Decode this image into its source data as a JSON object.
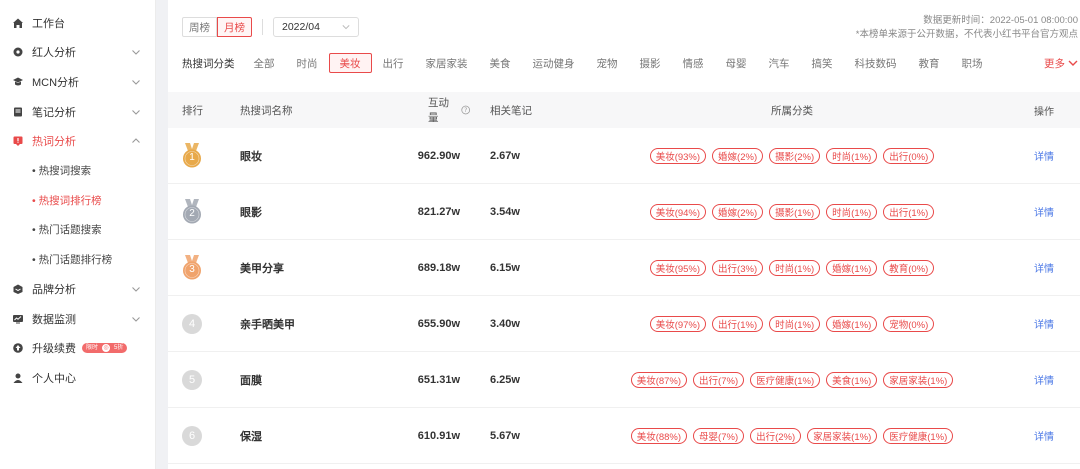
{
  "sidebar": {
    "items": [
      {
        "label": "工作台",
        "icon": "home-icon",
        "chevron": false,
        "active": false
      },
      {
        "label": "红人分析",
        "icon": "gear-icon",
        "chevron": true,
        "active": false
      },
      {
        "label": "MCN分析",
        "icon": "cap-icon",
        "chevron": true,
        "active": false
      },
      {
        "label": "笔记分析",
        "icon": "note-icon",
        "chevron": true,
        "active": false
      },
      {
        "label": "热词分析",
        "icon": "hot-word-icon",
        "chevron": true,
        "active": true,
        "expanded": true
      }
    ],
    "sub_items": [
      {
        "label": "• 热搜词搜索",
        "active": false
      },
      {
        "label": "• 热搜词排行榜",
        "active": true
      },
      {
        "label": "• 热门话题搜索",
        "active": false
      },
      {
        "label": "• 热门话题排行榜",
        "active": false
      }
    ],
    "items_after": [
      {
        "label": "品牌分析",
        "icon": "brand-icon",
        "chevron": true
      },
      {
        "label": "数据监测",
        "icon": "monitor-icon",
        "chevron": true
      },
      {
        "label": "升级续费",
        "icon": "upgrade-icon",
        "chevron": false,
        "badge_left": "限时",
        "badge_right": "5折"
      },
      {
        "label": "个人中心",
        "icon": "user-icon",
        "chevron": false
      }
    ]
  },
  "toolbar": {
    "week_label": "周榜",
    "month_label": "月榜",
    "date_value": "2022/04",
    "update_time": "数据更新时间：2022-05-01 08:00:00",
    "disclaimer": "*本榜单来源于公开数据，不代表小红书平台官方观点"
  },
  "categories": {
    "label": "热搜词分类",
    "items": [
      "全部",
      "时尚",
      "美妆",
      "出行",
      "家居家装",
      "美食",
      "运动健身",
      "宠物",
      "摄影",
      "情感",
      "母婴",
      "汽车",
      "搞笑",
      "科技数码",
      "教育",
      "职场"
    ],
    "active_index": 2,
    "more_label": "更多"
  },
  "table": {
    "headers": {
      "rank": "排行",
      "name": "热搜词名称",
      "interactions": "互动量",
      "notes": "相关笔记",
      "categories": "所属分类",
      "ops": "操作"
    },
    "op_label": "详情",
    "rows": [
      {
        "rank": "1",
        "name": "眼妆",
        "interactions": "962.90w",
        "notes": "2.67w",
        "tags": [
          "美妆(93%)",
          "婚嫁(2%)",
          "摄影(2%)",
          "时尚(1%)",
          "出行(0%)"
        ]
      },
      {
        "rank": "2",
        "name": "眼影",
        "interactions": "821.27w",
        "notes": "3.54w",
        "tags": [
          "美妆(94%)",
          "婚嫁(2%)",
          "摄影(1%)",
          "时尚(1%)",
          "出行(1%)"
        ]
      },
      {
        "rank": "3",
        "name": "美甲分享",
        "interactions": "689.18w",
        "notes": "6.15w",
        "tags": [
          "美妆(95%)",
          "出行(3%)",
          "时尚(1%)",
          "婚嫁(1%)",
          "教育(0%)"
        ]
      },
      {
        "rank": "4",
        "name": "亲手晒美甲",
        "interactions": "655.90w",
        "notes": "3.40w",
        "tags": [
          "美妆(97%)",
          "出行(1%)",
          "时尚(1%)",
          "婚嫁(1%)",
          "宠物(0%)"
        ]
      },
      {
        "rank": "5",
        "name": "面膜",
        "interactions": "651.31w",
        "notes": "6.25w",
        "tags": [
          "美妆(87%)",
          "出行(7%)",
          "医疗健康(1%)",
          "美食(1%)",
          "家居家装(1%)"
        ]
      },
      {
        "rank": "6",
        "name": "保湿",
        "interactions": "610.91w",
        "notes": "5.67w",
        "tags": [
          "美妆(88%)",
          "母婴(7%)",
          "出行(2%)",
          "家居家装(1%)",
          "医疗健康(1%)"
        ]
      }
    ]
  },
  "colors": {
    "accent": "#e94a4a",
    "link": "#4a77e6",
    "gold": "#e8a94a",
    "silver": "#a3a9b3",
    "bronze": "#f0a36c",
    "rank_gray": "#d9d9d9"
  }
}
